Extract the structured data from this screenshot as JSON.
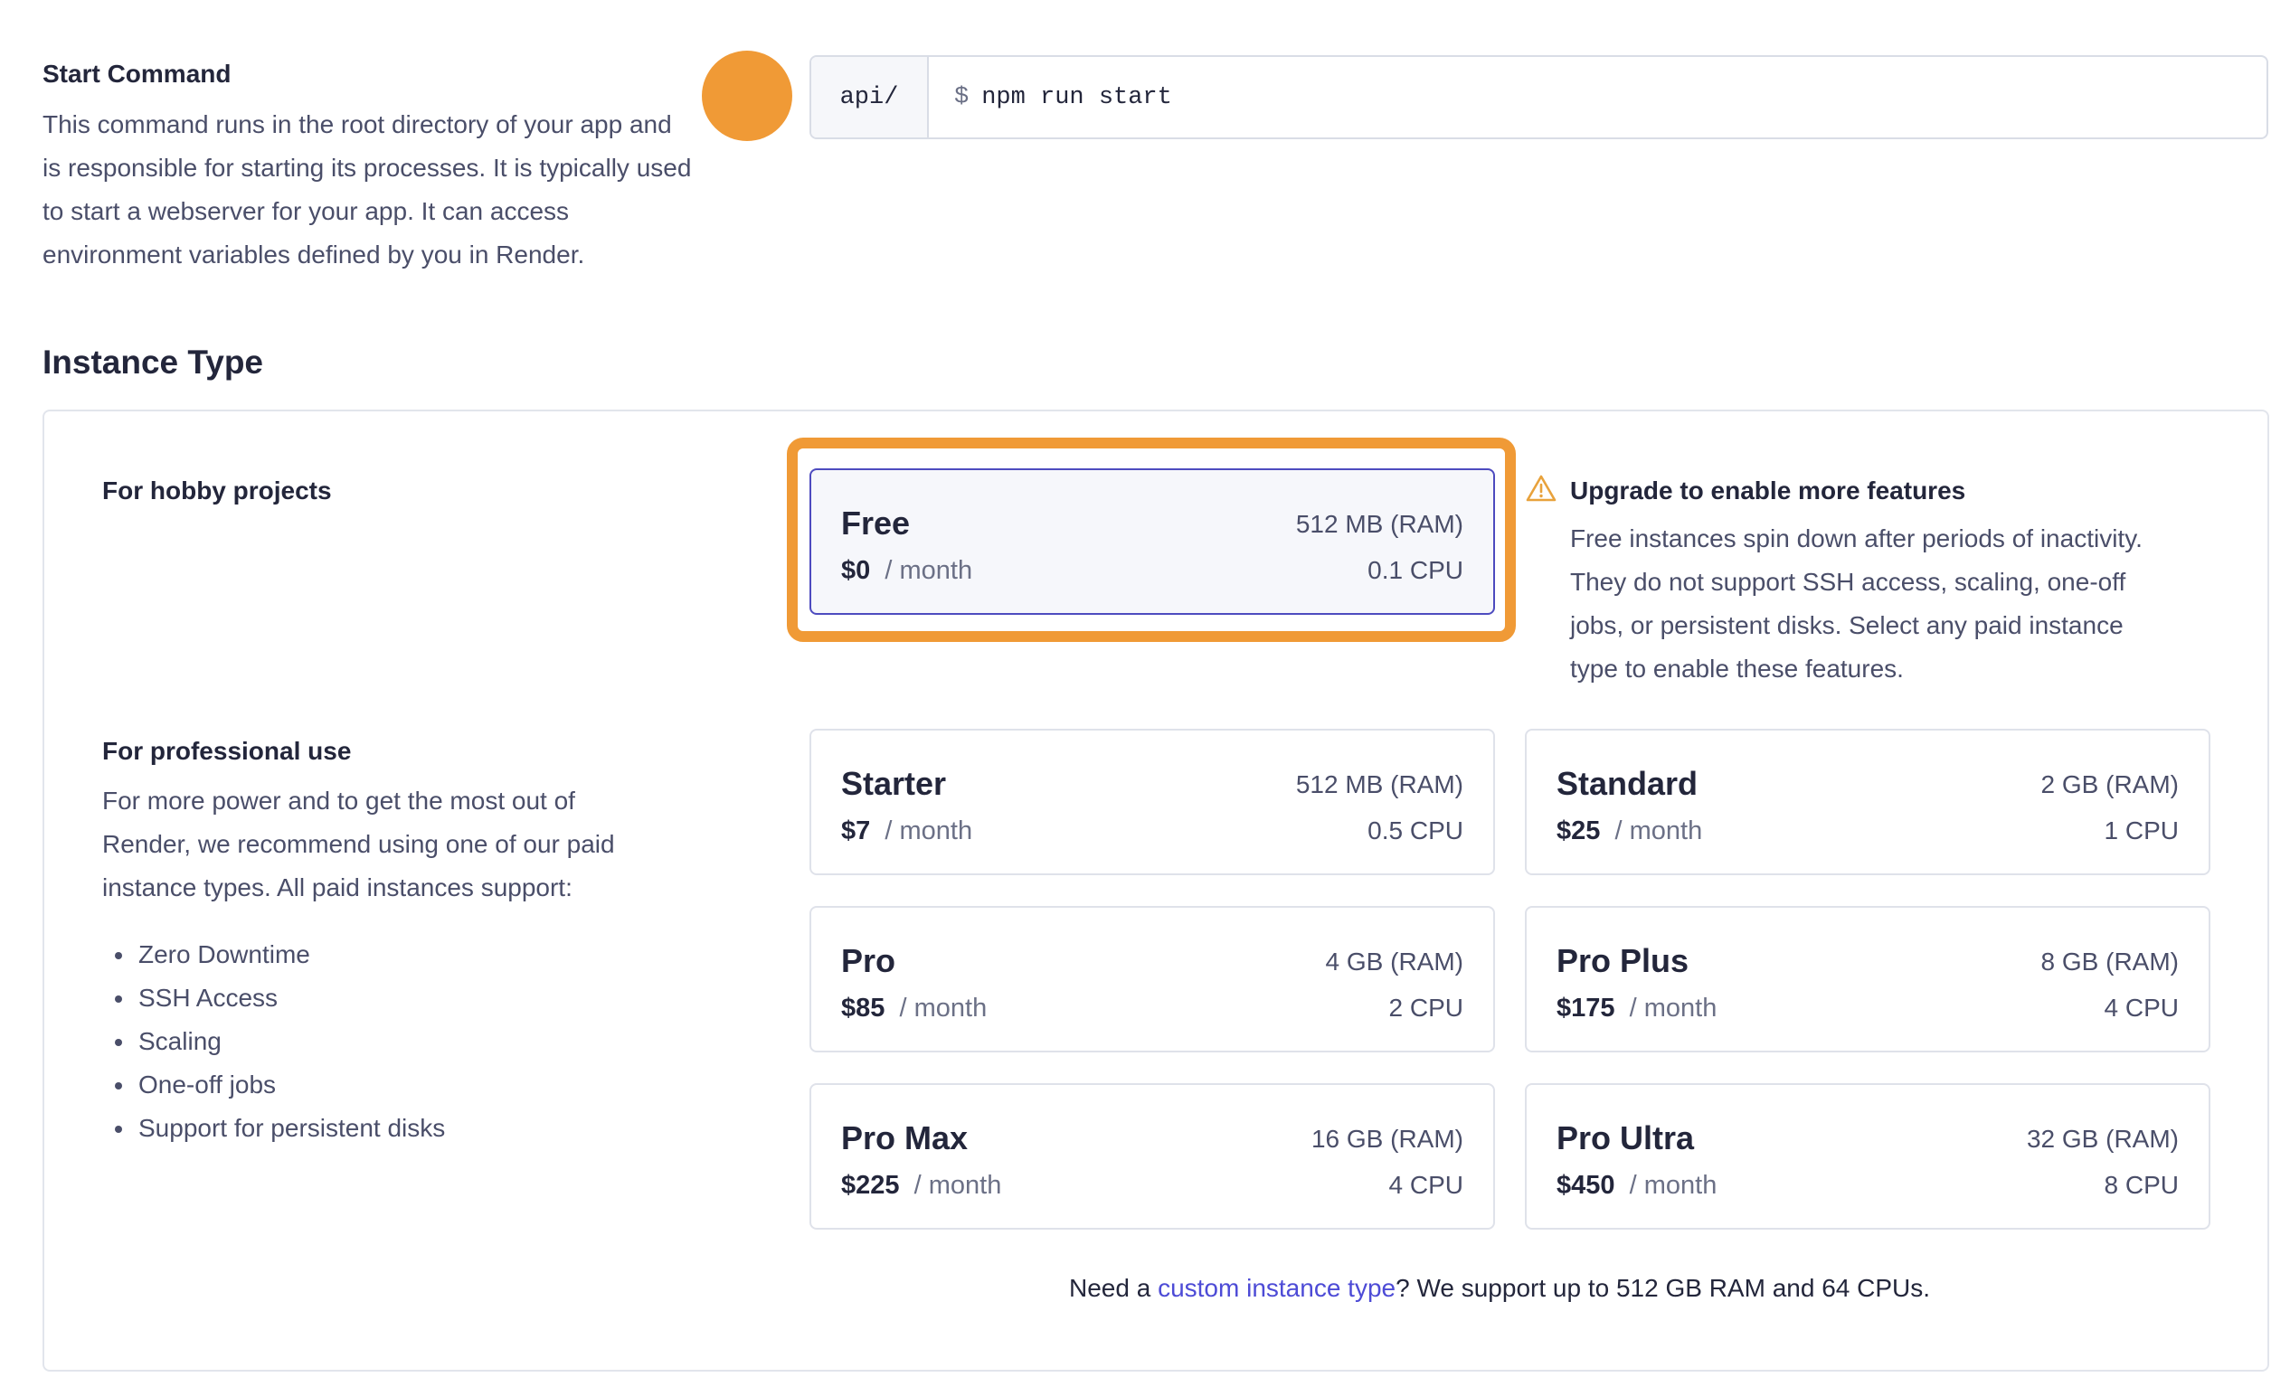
{
  "start_command": {
    "title": "Start Command",
    "description_lines": [
      "This command runs in the root directory of your app and",
      "is responsible for starting its processes. It is typically used",
      "to start a webserver for your app. It can access",
      "environment variables defined by you in Render."
    ],
    "prefix": "api/",
    "dollar": "$",
    "value": "npm run start"
  },
  "instance_type": {
    "title": "Instance Type",
    "hobby": {
      "label": "For hobby projects",
      "card": {
        "name": "Free",
        "price": "$0",
        "period": "/ month",
        "ram": "512 MB (RAM)",
        "cpu": "0.1 CPU",
        "selected": true
      }
    },
    "upgrade": {
      "title": "Upgrade to enable more features",
      "description_lines": [
        "Free instances spin down after periods of inactivity.",
        "They do not support SSH access, scaling, one-off",
        "jobs, or persistent disks. Select any paid instance",
        "type to enable these features."
      ]
    },
    "professional": {
      "label": "For professional use",
      "description_lines": [
        "For more power and to get the most out of",
        "Render, we recommend using one of our paid",
        "instance types. All paid instances support:"
      ],
      "features": [
        "Zero Downtime",
        "SSH Access",
        "Scaling",
        "One-off jobs",
        "Support for persistent disks"
      ],
      "cards": [
        {
          "name": "Starter",
          "price": "$7",
          "period": "/ month",
          "ram": "512 MB (RAM)",
          "cpu": "0.5 CPU"
        },
        {
          "name": "Standard",
          "price": "$25",
          "period": "/ month",
          "ram": "2 GB (RAM)",
          "cpu": "1 CPU"
        },
        {
          "name": "Pro",
          "price": "$85",
          "period": "/ month",
          "ram": "4 GB (RAM)",
          "cpu": "2 CPU"
        },
        {
          "name": "Pro Plus",
          "price": "$175",
          "period": "/ month",
          "ram": "8 GB (RAM)",
          "cpu": "4 CPU"
        },
        {
          "name": "Pro Max",
          "price": "$225",
          "period": "/ month",
          "ram": "16 GB (RAM)",
          "cpu": "4 CPU"
        },
        {
          "name": "Pro Ultra",
          "price": "$450",
          "period": "/ month",
          "ram": "32 GB (RAM)",
          "cpu": "8 CPU"
        }
      ]
    },
    "custom_note": {
      "before": "Need a ",
      "link": "custom instance type",
      "after": "? We support up to 512 GB RAM and 64 CPUs."
    }
  },
  "colors": {
    "accent_orange": "#f09a36",
    "selected_border": "#4d4bbf",
    "link": "#4d4bd6",
    "warning": "#e8a23c"
  },
  "icons": {
    "warning": "warning-triangle-icon"
  }
}
